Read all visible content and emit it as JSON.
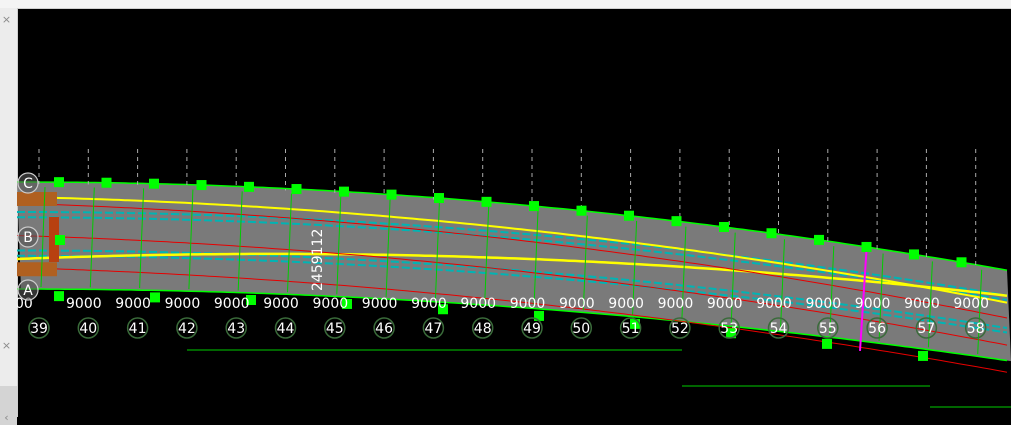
{
  "left_panel": {
    "close_glyph_top": "×",
    "close_glyph_bottom": "×",
    "arrow_glyph": "‹"
  },
  "drawing": {
    "background": "#000000",
    "colors": {
      "slab": "#7a7a7a",
      "grip": "#00ff00",
      "beam": "#ffff00",
      "centerline": "#00b4b4",
      "red_line": "#e60000",
      "axis_line": "#00cc00",
      "magenta": "#ff00ff",
      "label": "#ffffff",
      "grid_bubble": "#3a6b3a"
    },
    "row_axes": [
      "C",
      "B",
      "A"
    ],
    "column_axes": [
      "39",
      "40",
      "41",
      "42",
      "43",
      "44",
      "45",
      "46",
      "47",
      "48",
      "49",
      "50",
      "51",
      "52",
      "53",
      "54",
      "55",
      "56",
      "57",
      "58"
    ],
    "bay_spacing_labels": [
      "00",
      "9000",
      "9000",
      "9000",
      "9000",
      "9000",
      "9000",
      "9000",
      "9000",
      "9000",
      "9000",
      "9000",
      "9000",
      "9000",
      "9000",
      "9000",
      "9000",
      "9000",
      "9000",
      "9000"
    ],
    "vertical_dimension": "2459112"
  }
}
